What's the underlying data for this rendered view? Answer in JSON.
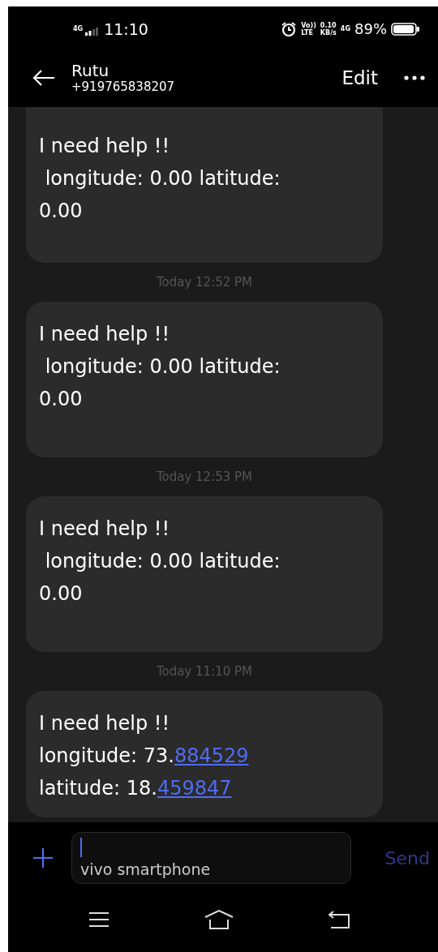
{
  "status_bar": {
    "network": "4G",
    "time": "11:10",
    "volte": "Vo))",
    "lte": "LTE",
    "speed": "0.10",
    "speed_unit": "KB/s",
    "network_2": "4G",
    "battery": "89%"
  },
  "header": {
    "name": "Rutu",
    "number": "+919765838207",
    "edit": "Edit"
  },
  "thread": [
    {
      "kind": "message",
      "lines": [
        {
          "text": "I need help !!"
        },
        {
          "text": " longitude: 0.00 latitude:"
        },
        {
          "text": "0.00"
        }
      ]
    },
    {
      "kind": "timestamp",
      "text": "Today 12:52 PM"
    },
    {
      "kind": "message",
      "lines": [
        {
          "text": "I need help !!"
        },
        {
          "text": " longitude: 0.00 latitude:"
        },
        {
          "text": "0.00"
        }
      ]
    },
    {
      "kind": "timestamp",
      "text": "Today 12:53 PM"
    },
    {
      "kind": "message",
      "lines": [
        {
          "text": "I need help !!"
        },
        {
          "text": " longitude: 0.00 latitude:"
        },
        {
          "text": "0.00"
        }
      ]
    },
    {
      "kind": "timestamp",
      "text": "Today 11:10 PM"
    },
    {
      "kind": "message",
      "lines": [
        {
          "text": "I need help !!"
        },
        {
          "text": "longitude: 73.",
          "link": "884529"
        },
        {
          "text": "latitude: 18.",
          "link": "459847"
        }
      ]
    }
  ],
  "composer": {
    "signature": "vivo smartphone",
    "send": "Send"
  }
}
